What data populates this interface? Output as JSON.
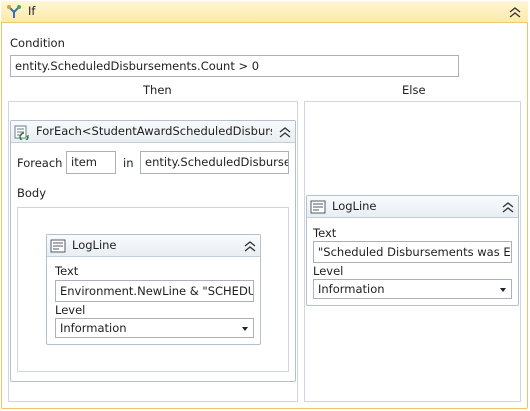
{
  "if": {
    "title": "If",
    "condition_label": "Condition",
    "condition_value": "entity.ScheduledDisbursements.Count > 0",
    "then_label": "Then",
    "else_label": "Else"
  },
  "foreach": {
    "title": "ForEach<StudentAwardScheduledDisburser",
    "foreach_label": "Foreach",
    "item_value": "item",
    "in_label": "in",
    "collection_value": "entity.ScheduledDisburser",
    "body_label": "Body"
  },
  "logline_then": {
    "title": "LogLine",
    "text_label": "Text",
    "text_value": "Environment.NewLine & \"SCHEDUL",
    "level_label": "Level",
    "level_value": "Information"
  },
  "logline_else": {
    "title": "LogLine",
    "text_label": "Text",
    "text_value": "\"Scheduled Disbursements was Emp",
    "level_label": "Level",
    "level_value": "Information"
  }
}
